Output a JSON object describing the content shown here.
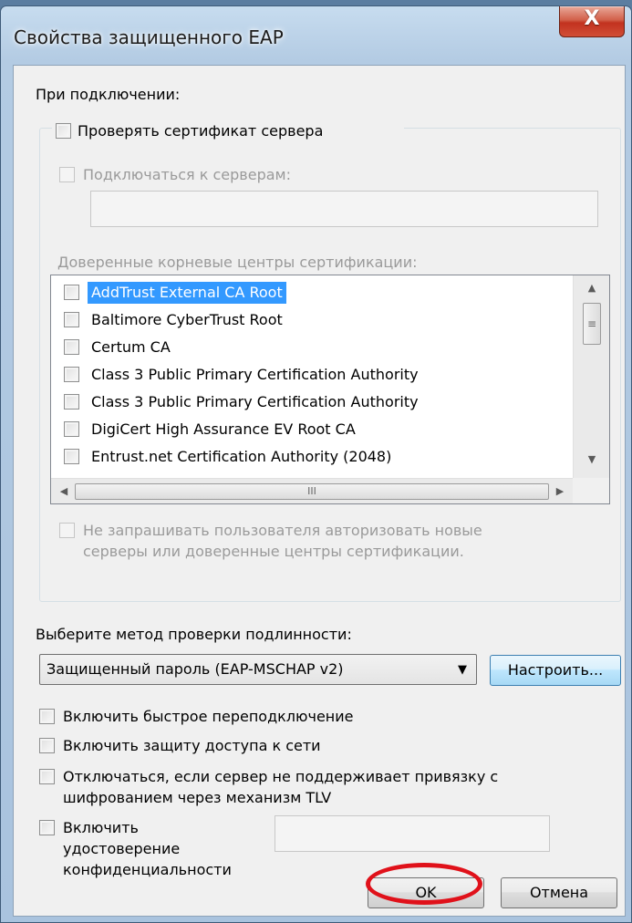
{
  "window": {
    "title": "Свойства защищенного EAP",
    "close_glyph": "X"
  },
  "on_connect": {
    "label": "При подключении:",
    "verify_cert": {
      "label": "Проверять сертификат сервера",
      "checked": false
    },
    "connect_to_servers": {
      "label": "Подключаться к серверам:",
      "checked": false,
      "value": ""
    },
    "trusted_roots_label": "Доверенные корневые центры сертификации:",
    "trusted_roots": [
      {
        "label": "AddTrust External CA Root",
        "checked": false,
        "selected": true
      },
      {
        "label": "Baltimore CyberTrust Root",
        "checked": false,
        "selected": false
      },
      {
        "label": "Certum CA",
        "checked": false,
        "selected": false
      },
      {
        "label": "Class 3 Public Primary Certification Authority",
        "checked": false,
        "selected": false
      },
      {
        "label": "Class 3 Public Primary Certification Authority",
        "checked": false,
        "selected": false
      },
      {
        "label": "DigiCert High Assurance EV Root CA",
        "checked": false,
        "selected": false
      },
      {
        "label": "Entrust.net Certification Authority (2048)",
        "checked": false,
        "selected": false
      }
    ],
    "scroll_glyphs": {
      "up": "▲",
      "down": "▼",
      "left": "◀",
      "right": "▶",
      "vgrip": "≡",
      "hgrip": "III"
    },
    "dont_prompt": {
      "line1": "Не запрашивать пользователя авторизовать новые",
      "line2": "серверы или доверенные центры сертификации.",
      "checked": false
    }
  },
  "auth": {
    "label": "Выберите метод проверки подлинности:",
    "method": "Защищенный пароль (EAP-MSCHAP v2)",
    "dropdown_glyph": "▼",
    "configure_label": "Настроить..."
  },
  "options": {
    "fast_reconnect": {
      "label": "Включить быстрое переподключение",
      "checked": false
    },
    "nap": {
      "label": "Включить защиту доступа к сети",
      "checked": false
    },
    "tlv": {
      "line1": "Отключаться, если сервер не поддерживает привязку с",
      "line2": "шифрованием через механизм TLV",
      "checked": false
    },
    "identity_privacy": {
      "line1": "Включить",
      "line2": "удостоверение",
      "line3": "конфиденциальности",
      "checked": false,
      "value": ""
    }
  },
  "buttons": {
    "ok": "OK",
    "cancel": "Отмена"
  },
  "colors": {
    "selection": "#3399ff",
    "annotation_circle": "#e0111a"
  }
}
